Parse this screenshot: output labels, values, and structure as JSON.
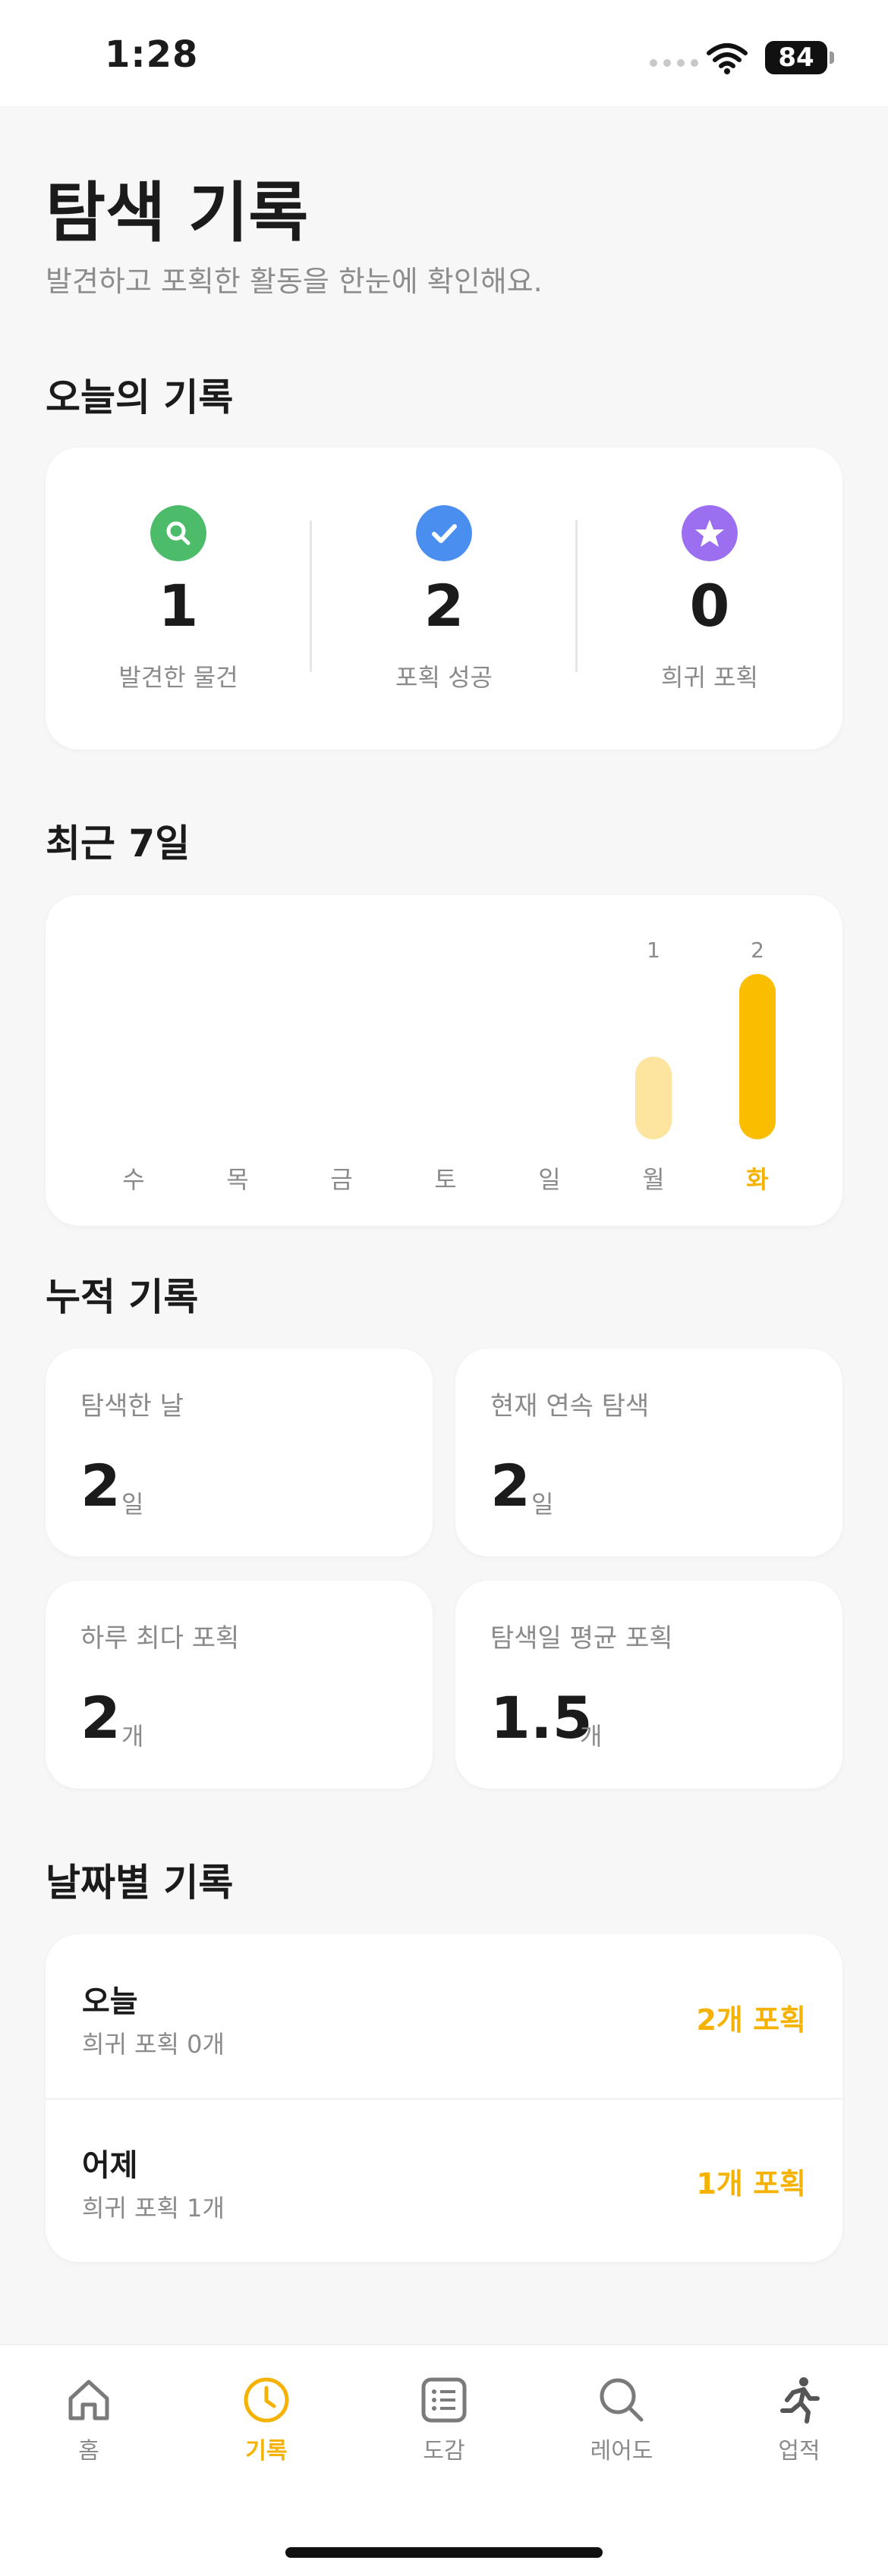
{
  "status": {
    "time": "1:28",
    "battery": "84"
  },
  "header": {
    "title": "탐색 기록",
    "subtitle": "발견하고 포획한 활동을 한눈에 확인해요."
  },
  "today": {
    "title": "오늘의 기록",
    "stats": [
      {
        "icon": "search-icon",
        "value": "1",
        "label": "발견한 물건",
        "color": "#4cbb6a"
      },
      {
        "icon": "check-icon",
        "value": "2",
        "label": "포획 성공",
        "color": "#4a8ef0"
      },
      {
        "icon": "star-icon",
        "value": "0",
        "label": "희귀 포획",
        "color": "#9b6ff0"
      }
    ]
  },
  "recent": {
    "title": "최근 7일",
    "chart_data": {
      "type": "bar",
      "categories": [
        "수",
        "목",
        "금",
        "토",
        "일",
        "월",
        "화"
      ],
      "values": [
        0,
        0,
        0,
        0,
        0,
        1,
        2
      ],
      "value_labels": [
        "",
        "",
        "",
        "",
        "",
        "1",
        "2"
      ],
      "highlight_index": 6,
      "colors": {
        "highlight": "#fbbd00",
        "normal": "#fde5a0"
      }
    }
  },
  "cumulative": {
    "title": "누적 기록",
    "cards": [
      {
        "label": "탐색한 날",
        "value": "2",
        "unit": "일"
      },
      {
        "label": "현재 연속 탐색",
        "value": "2",
        "unit": "일"
      },
      {
        "label": "하루 최다 포획",
        "value": "2",
        "unit": "개"
      },
      {
        "label": "탐색일 평균 포획",
        "value": "1.5",
        "unit": "개"
      }
    ]
  },
  "by_date": {
    "title": "날짜별 기록",
    "rows": [
      {
        "title": "오늘",
        "sub": "희귀 포획 0개",
        "catch": "2개 포획"
      },
      {
        "title": "어제",
        "sub": "희귀 포획 1개",
        "catch": "1개 포획"
      }
    ]
  },
  "tabs": [
    {
      "label": "홈",
      "icon": "home-icon",
      "active": false
    },
    {
      "label": "기록",
      "icon": "clock-icon",
      "active": true
    },
    {
      "label": "도감",
      "icon": "list-icon",
      "active": false
    },
    {
      "label": "레어도",
      "icon": "magnifier-icon",
      "active": false
    },
    {
      "label": "업적",
      "icon": "runner-icon",
      "active": false
    }
  ],
  "colors": {
    "accent": "#f5b200"
  }
}
